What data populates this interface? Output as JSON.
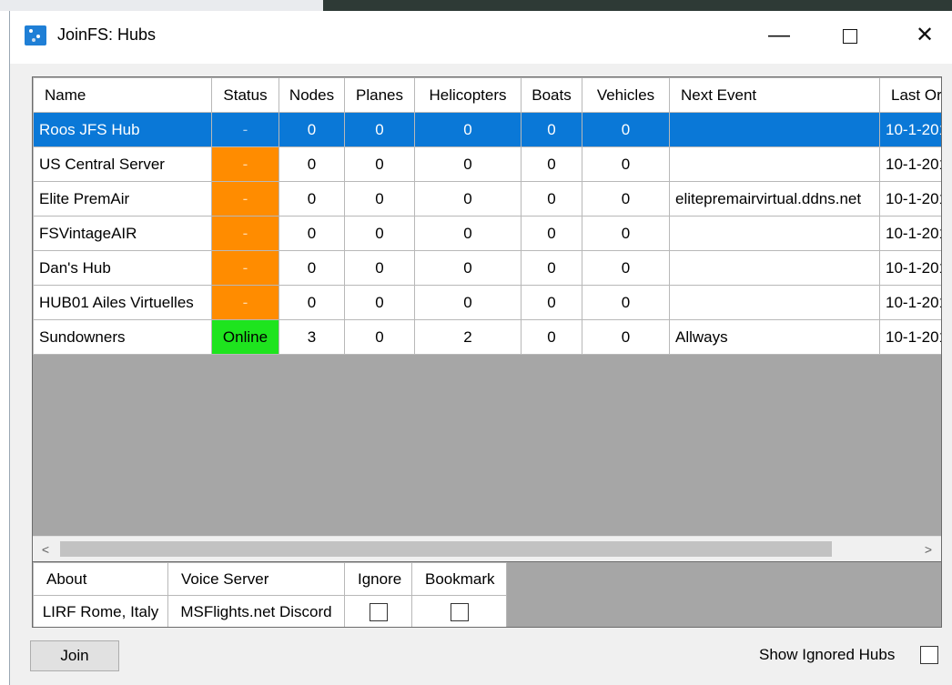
{
  "window": {
    "title": "JoinFS: Hubs"
  },
  "titlebar_buttons": {
    "minimize": "—",
    "close": "✕"
  },
  "grid": {
    "columns": [
      "Name",
      "Status",
      "Nodes",
      "Planes",
      "Helicopters",
      "Boats",
      "Vehicles",
      "Next Event",
      "Last Or"
    ],
    "rows": [
      {
        "name": "Roos JFS Hub",
        "status": "-",
        "status_color": "selected",
        "nodes": "0",
        "planes": "0",
        "helicopters": "0",
        "boats": "0",
        "vehicles": "0",
        "next_event": "",
        "last_online": "10-1-201",
        "selected": true
      },
      {
        "name": "US Central Server",
        "status": "-",
        "status_color": "#ff8c00",
        "nodes": "0",
        "planes": "0",
        "helicopters": "0",
        "boats": "0",
        "vehicles": "0",
        "next_event": "",
        "last_online": "10-1-201"
      },
      {
        "name": "Elite PremAir",
        "status": "-",
        "status_color": "#ff8c00",
        "nodes": "0",
        "planes": "0",
        "helicopters": "0",
        "boats": "0",
        "vehicles": "0",
        "next_event": "elitepremairvirtual.ddns.net",
        "last_online": "10-1-201"
      },
      {
        "name": "FSVintageAIR",
        "status": "-",
        "status_color": "#ff8c00",
        "nodes": "0",
        "planes": "0",
        "helicopters": "0",
        "boats": "0",
        "vehicles": "0",
        "next_event": "",
        "last_online": "10-1-201"
      },
      {
        "name": "Dan's Hub",
        "status": "-",
        "status_color": "#ff8c00",
        "nodes": "0",
        "planes": "0",
        "helicopters": "0",
        "boats": "0",
        "vehicles": "0",
        "next_event": "",
        "last_online": "10-1-201"
      },
      {
        "name": "HUB01 Ailes Virtuelles",
        "status": "-",
        "status_color": "#ff8c00",
        "nodes": "0",
        "planes": "0",
        "helicopters": "0",
        "boats": "0",
        "vehicles": "0",
        "next_event": "",
        "last_online": "10-1-201"
      },
      {
        "name": "Sundowners",
        "status": "Online",
        "status_color": "#1ee41e",
        "nodes": "3",
        "planes": "0",
        "helicopters": "2",
        "boats": "0",
        "vehicles": "0",
        "next_event": "Allways",
        "last_online": "10-1-201"
      }
    ]
  },
  "scrollbar": {
    "left_arrow": "<",
    "right_arrow": ">"
  },
  "detail": {
    "columns": [
      "About",
      "Voice Server",
      "Ignore",
      "Bookmark"
    ],
    "about": "LIRF Rome, Italy",
    "voice_server": "MSFlights.net Discord",
    "ignore_checked": false,
    "bookmark_checked": false
  },
  "footer": {
    "join_label": "Join",
    "show_ignored_label": "Show Ignored Hubs",
    "show_ignored_checked": false
  }
}
